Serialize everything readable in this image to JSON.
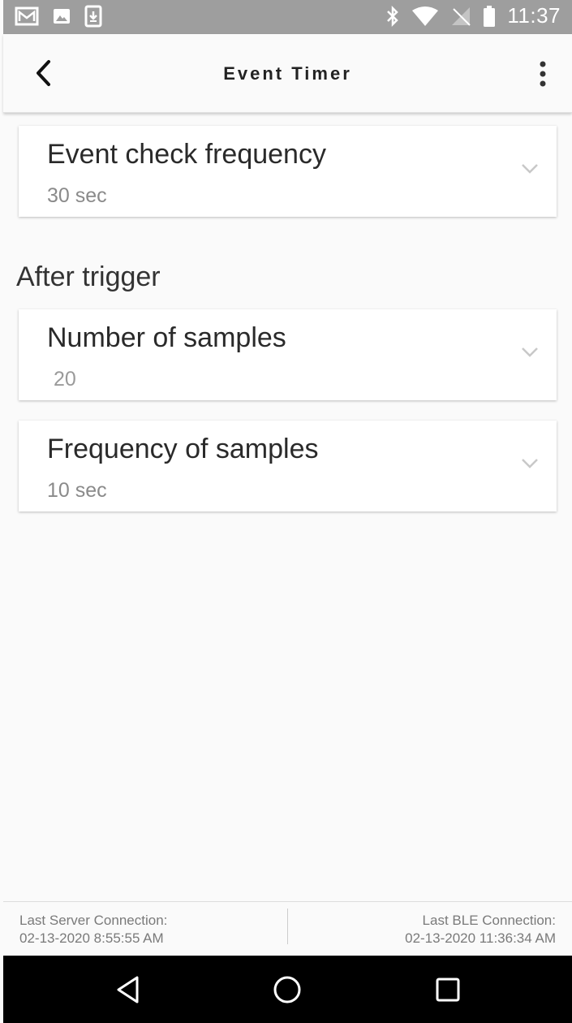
{
  "status_bar": {
    "time": "11:37",
    "left_icons": [
      "gmail-icon",
      "image-icon",
      "download-icon"
    ],
    "right_icons": [
      "bluetooth-icon",
      "wifi-icon",
      "no-sim-icon",
      "battery-icon"
    ]
  },
  "app_bar": {
    "title": "Event Timer"
  },
  "settings": {
    "event_check": {
      "label": "Event check frequency",
      "value": "30 sec"
    },
    "section_title": "After trigger",
    "num_samples": {
      "label": "Number of samples",
      "value": "20"
    },
    "freq_samples": {
      "label": "Frequency of samples",
      "value": "10 sec"
    }
  },
  "footer": {
    "server_label": "Last Server Connection:",
    "server_time": "02-13-2020 8:55:55 AM",
    "ble_label": "Last BLE Connection:",
    "ble_time": "02-13-2020 11:36:34 AM"
  },
  "colors": {
    "status_bar": "#9e9e9e",
    "background": "#fafafa",
    "card": "#ffffff",
    "nav_bar": "#000000"
  }
}
